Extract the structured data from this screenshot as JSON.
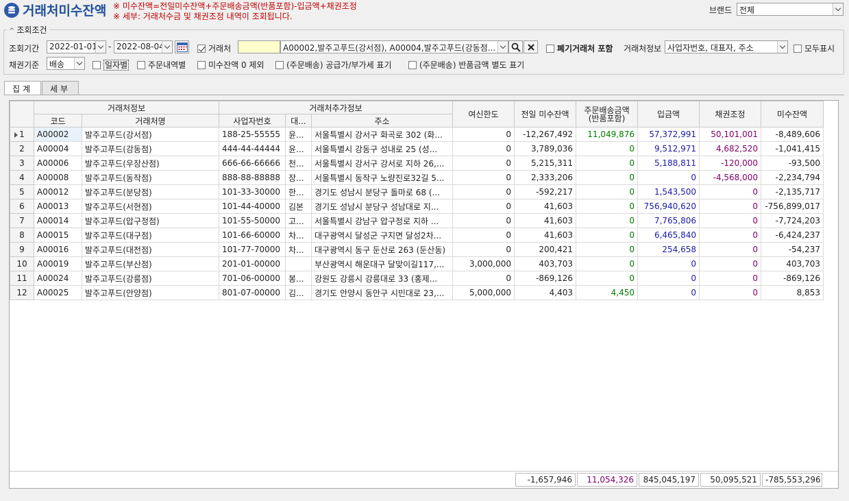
{
  "header": {
    "title": "거래처미수잔액",
    "note1": "※ 미수잔액=전일미수잔액+주문배송금액(반품포함)-입금액+채권조정",
    "note2": "※ 세부: 거래처수금 및 채권조정 내역이 조회됩니다.",
    "brand_label": "브랜드",
    "brand_value": "전체"
  },
  "conditions": {
    "group_title": "조회조건",
    "period_label": "조회기간",
    "date_from": "2022-01-01",
    "date_sep": "-",
    "date_to": "2022-08-04",
    "client_label": "거래처",
    "client_code": "",
    "client_value": "A00002,발주고푸드(강서점), A00004,발주고푸드(강동점...",
    "include_closed_label": "폐기거래처 포함",
    "client_info_label": "거래처정보",
    "client_info_value": "사업자번호, 대표자, 주소",
    "show_all_label": "모두표시",
    "basis_label": "채권기준",
    "basis_value": "배송",
    "daily_label": "일자별",
    "order_detail_label": "주문내역별",
    "exclude_zero_label": "미수잔액 0 제외",
    "supply_vat_label": "(주문배송) 공급가/부가세 표기",
    "return_sep_label": "(주문배송) 반품금액 별도 표기"
  },
  "tabs": [
    {
      "label": "집계"
    },
    {
      "label": "세부"
    }
  ],
  "grid": {
    "group_headers": {
      "client_info": "거래처정보",
      "client_extra": "거래처추가정보"
    },
    "columns": {
      "code": "코드",
      "name": "거래처명",
      "bizno": "사업자번호",
      "rep": "대...",
      "address": "주소",
      "credit": "여신한도",
      "prev_balance": "전일 미수잔액",
      "order_amount": "주문배송금액",
      "order_amount_sub": "(반품포함)",
      "deposit": "입금액",
      "adjust": "채권조정",
      "balance": "미수잔액"
    },
    "rows": [
      {
        "no": "1",
        "code": "A00002",
        "name": "발주고푸드(강서점)",
        "bizno": "188-25-55555",
        "rep": "윤...",
        "address": "서울특별시 강서구 화곡로 302 (화...",
        "credit": "0",
        "prev": "-12,267,492",
        "order": "11,049,876",
        "deposit": "57,372,991",
        "adjust": "50,101,001",
        "balance": "-8,489,606"
      },
      {
        "no": "2",
        "code": "A00004",
        "name": "발주고푸드(강동점)",
        "bizno": "444-44-44444",
        "rep": "윤...",
        "address": "서울특별시 강동구 성내로 25 (성...",
        "credit": "0",
        "prev": "3,789,036",
        "order": "0",
        "deposit": "9,512,971",
        "adjust": "4,682,520",
        "balance": "-1,041,415"
      },
      {
        "no": "3",
        "code": "A00006",
        "name": "발주고푸드(우장산점)",
        "bizno": "666-66-66666",
        "rep": "천...",
        "address": "서울특별시 강서구 강서로 지하 26,...",
        "credit": "0",
        "prev": "5,215,311",
        "order": "0",
        "deposit": "5,188,811",
        "adjust": "-120,000",
        "balance": "-93,500"
      },
      {
        "no": "4",
        "code": "A00008",
        "name": "발주고푸드(동작점)",
        "bizno": "888-88-88888",
        "rep": "장...",
        "address": "서울특별시 동작구 노량진로32길 5...",
        "credit": "0",
        "prev": "2,333,206",
        "order": "0",
        "deposit": "0",
        "adjust": "-4,568,000",
        "balance": "-2,234,794"
      },
      {
        "no": "5",
        "code": "A00012",
        "name": "발주고푸드(분당점)",
        "bizno": "101-33-30000",
        "rep": "한...",
        "address": "경기도 성남시 분당구 돌마로 68 (...",
        "credit": "0",
        "prev": "-592,217",
        "order": "0",
        "deposit": "1,543,500",
        "adjust": "0",
        "balance": "-2,135,717"
      },
      {
        "no": "6",
        "code": "A00013",
        "name": "발주고푸드(서현점)",
        "bizno": "101-44-40000",
        "rep": "김본",
        "address": "경기도 성남시 분당구 성남대로 지...",
        "credit": "0",
        "prev": "41,603",
        "order": "0",
        "deposit": "756,940,620",
        "adjust": "0",
        "balance": "-756,899,017"
      },
      {
        "no": "7",
        "code": "A00014",
        "name": "발주고푸드(압구정점)",
        "bizno": "101-55-50000",
        "rep": "고...",
        "address": "서울특별시 강남구 압구정로 지하 ...",
        "credit": "0",
        "prev": "41,603",
        "order": "0",
        "deposit": "7,765,806",
        "adjust": "0",
        "balance": "-7,724,203"
      },
      {
        "no": "8",
        "code": "A00015",
        "name": "발주고푸드(대구점)",
        "bizno": "101-66-60000",
        "rep": "차...",
        "address": "대구광역시 달성군 구지면 달성2차...",
        "credit": "0",
        "prev": "41,603",
        "order": "0",
        "deposit": "6,465,840",
        "adjust": "0",
        "balance": "-6,424,237"
      },
      {
        "no": "9",
        "code": "A00016",
        "name": "발주고푸드(대전점)",
        "bizno": "101-77-70000",
        "rep": "차...",
        "address": "대구광역시 동구 둔산로 263 (둔산동)",
        "credit": "0",
        "prev": "200,421",
        "order": "0",
        "deposit": "254,658",
        "adjust": "0",
        "balance": "-54,237"
      },
      {
        "no": "10",
        "code": "A00019",
        "name": "발주고푸드(부산점)",
        "bizno": "201-01-00000",
        "rep": "",
        "address": "부산광역시 해운대구 달맞이길117,...",
        "credit": "3,000,000",
        "prev": "403,703",
        "order": "0",
        "deposit": "0",
        "adjust": "0",
        "balance": "403,703"
      },
      {
        "no": "11",
        "code": "A00024",
        "name": "발주고푸드(강릉점)",
        "bizno": "701-06-00000",
        "rep": "봉...",
        "address": "강원도 강릉시 강릉대로 33 (홍제...",
        "credit": "0",
        "prev": "-869,126",
        "order": "0",
        "deposit": "0",
        "adjust": "0",
        "balance": "-869,126"
      },
      {
        "no": "12",
        "code": "A00025",
        "name": "발주고푸드(안양점)",
        "bizno": "801-07-00000",
        "rep": "김...",
        "address": "경기도 안양시 동안구 시민대로 23,...",
        "credit": "5,000,000",
        "prev": "4,403",
        "order": "4,450",
        "deposit": "0",
        "adjust": "0",
        "balance": "8,853"
      }
    ],
    "totals": {
      "prev": "-1,657,946",
      "order": "11,054,326",
      "deposit": "845,045,197",
      "adjust": "50,095,521",
      "balance": "-785,553,296"
    }
  },
  "colors": {
    "title": "#1f4f9a",
    "note": "#c00000",
    "green": "#007a00",
    "blue": "#1a1aa6",
    "purple": "#80006b"
  }
}
